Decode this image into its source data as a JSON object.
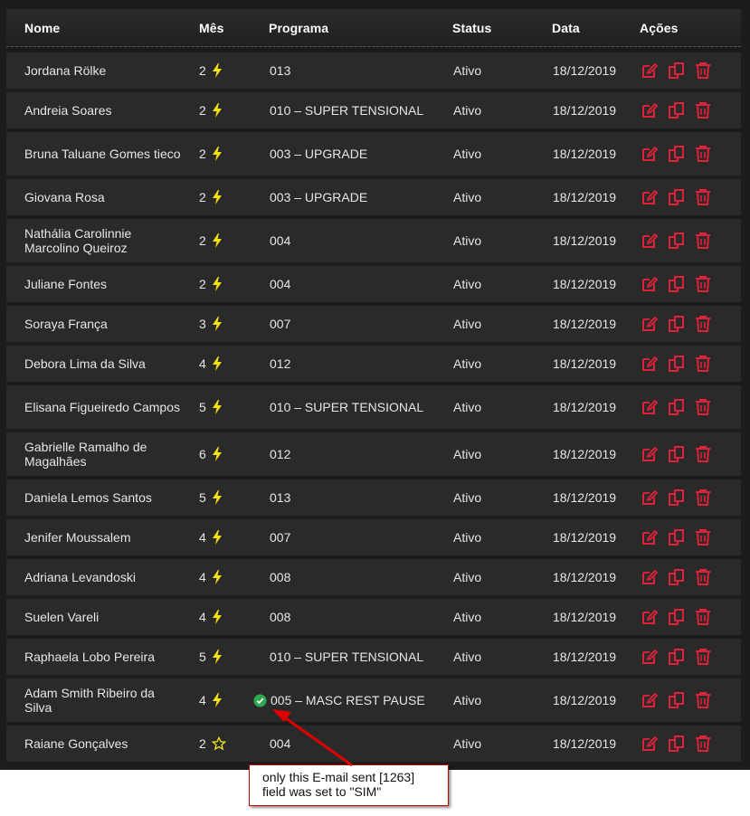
{
  "header": {
    "nome": "Nome",
    "mes": "Mês",
    "programa": "Programa",
    "status": "Status",
    "data": "Data",
    "acoes": "Ações"
  },
  "rows": [
    {
      "nome": "Jordana Rölke",
      "mes": "2",
      "mes_icon": "bolt-icon",
      "programa": "013",
      "status": "Ativo",
      "data": "18/12/2019"
    },
    {
      "nome": "Andreia Soares",
      "mes": "2",
      "mes_icon": "bolt-icon",
      "programa": "010 – SUPER TENSIONAL",
      "status": "Ativo",
      "data": "18/12/2019"
    },
    {
      "nome": "Bruna Taluane Gomes tieco",
      "mes": "2",
      "mes_icon": "bolt-icon",
      "programa": "003 – UPGRADE",
      "status": "Ativo",
      "data": "18/12/2019"
    },
    {
      "nome": "Giovana Rosa",
      "mes": "2",
      "mes_icon": "bolt-icon",
      "programa": "003 – UPGRADE",
      "status": "Ativo",
      "data": "18/12/2019"
    },
    {
      "nome": "Nathália Carolinnie Marcolino Queiroz",
      "mes": "2",
      "mes_icon": "bolt-icon",
      "programa": "004",
      "status": "Ativo",
      "data": "18/12/2019"
    },
    {
      "nome": "Juliane Fontes",
      "mes": "2",
      "mes_icon": "bolt-icon",
      "programa": "004",
      "status": "Ativo",
      "data": "18/12/2019"
    },
    {
      "nome": "Soraya França",
      "mes": "3",
      "mes_icon": "bolt-icon",
      "programa": "007",
      "status": "Ativo",
      "data": "18/12/2019"
    },
    {
      "nome": "Debora Lima da Silva",
      "mes": "4",
      "mes_icon": "bolt-icon",
      "programa": "012",
      "status": "Ativo",
      "data": "18/12/2019"
    },
    {
      "nome": "Elisana Figueiredo Campos",
      "mes": "5",
      "mes_icon": "bolt-icon",
      "programa": "010 – SUPER TENSIONAL",
      "status": "Ativo",
      "data": "18/12/2019"
    },
    {
      "nome": "Gabrielle Ramalho de Magalhães",
      "mes": "6",
      "mes_icon": "bolt-icon",
      "programa": "012",
      "status": "Ativo",
      "data": "18/12/2019"
    },
    {
      "nome": "Daniela Lemos Santos",
      "mes": "5",
      "mes_icon": "bolt-icon",
      "programa": "013",
      "status": "Ativo",
      "data": "18/12/2019"
    },
    {
      "nome": "Jenifer Moussalem",
      "mes": "4",
      "mes_icon": "bolt-icon",
      "programa": "007",
      "status": "Ativo",
      "data": "18/12/2019"
    },
    {
      "nome": "Adriana Levandoski",
      "mes": "4",
      "mes_icon": "bolt-icon",
      "programa": "008",
      "status": "Ativo",
      "data": "18/12/2019"
    },
    {
      "nome": "Suelen Vareli",
      "mes": "4",
      "mes_icon": "bolt-icon",
      "programa": "008",
      "status": "Ativo",
      "data": "18/12/2019"
    },
    {
      "nome": "Raphaela Lobo Pereira",
      "mes": "5",
      "mes_icon": "bolt-icon",
      "programa": "010 – SUPER TENSIONAL",
      "status": "Ativo",
      "data": "18/12/2019"
    },
    {
      "nome": "Adam Smith Ribeiro da Silva",
      "mes": "4",
      "mes_icon": "bolt-icon",
      "programa": "005 – MASC REST PAUSE",
      "programa_icon": "check-circle-icon",
      "status": "Ativo",
      "data": "18/12/2019"
    },
    {
      "nome": "Raiane Gonçalves",
      "mes": "2",
      "mes_icon": "star-outline-icon",
      "programa": "004",
      "status": "Ativo",
      "data": "18/12/2019"
    }
  ],
  "actions": [
    "edit-icon",
    "copy-icon",
    "trash-icon"
  ],
  "callout": {
    "line1": "only this E-mail sent [1263]",
    "line2": "field was set to \"SIM\""
  },
  "colors": {
    "background": "#1c1c1c",
    "row": "#2a2a2a",
    "accent_yellow": "#f2e318",
    "action_red": "#e0213a",
    "check_green": "#2fa84f",
    "annotation_red": "#e00000"
  }
}
